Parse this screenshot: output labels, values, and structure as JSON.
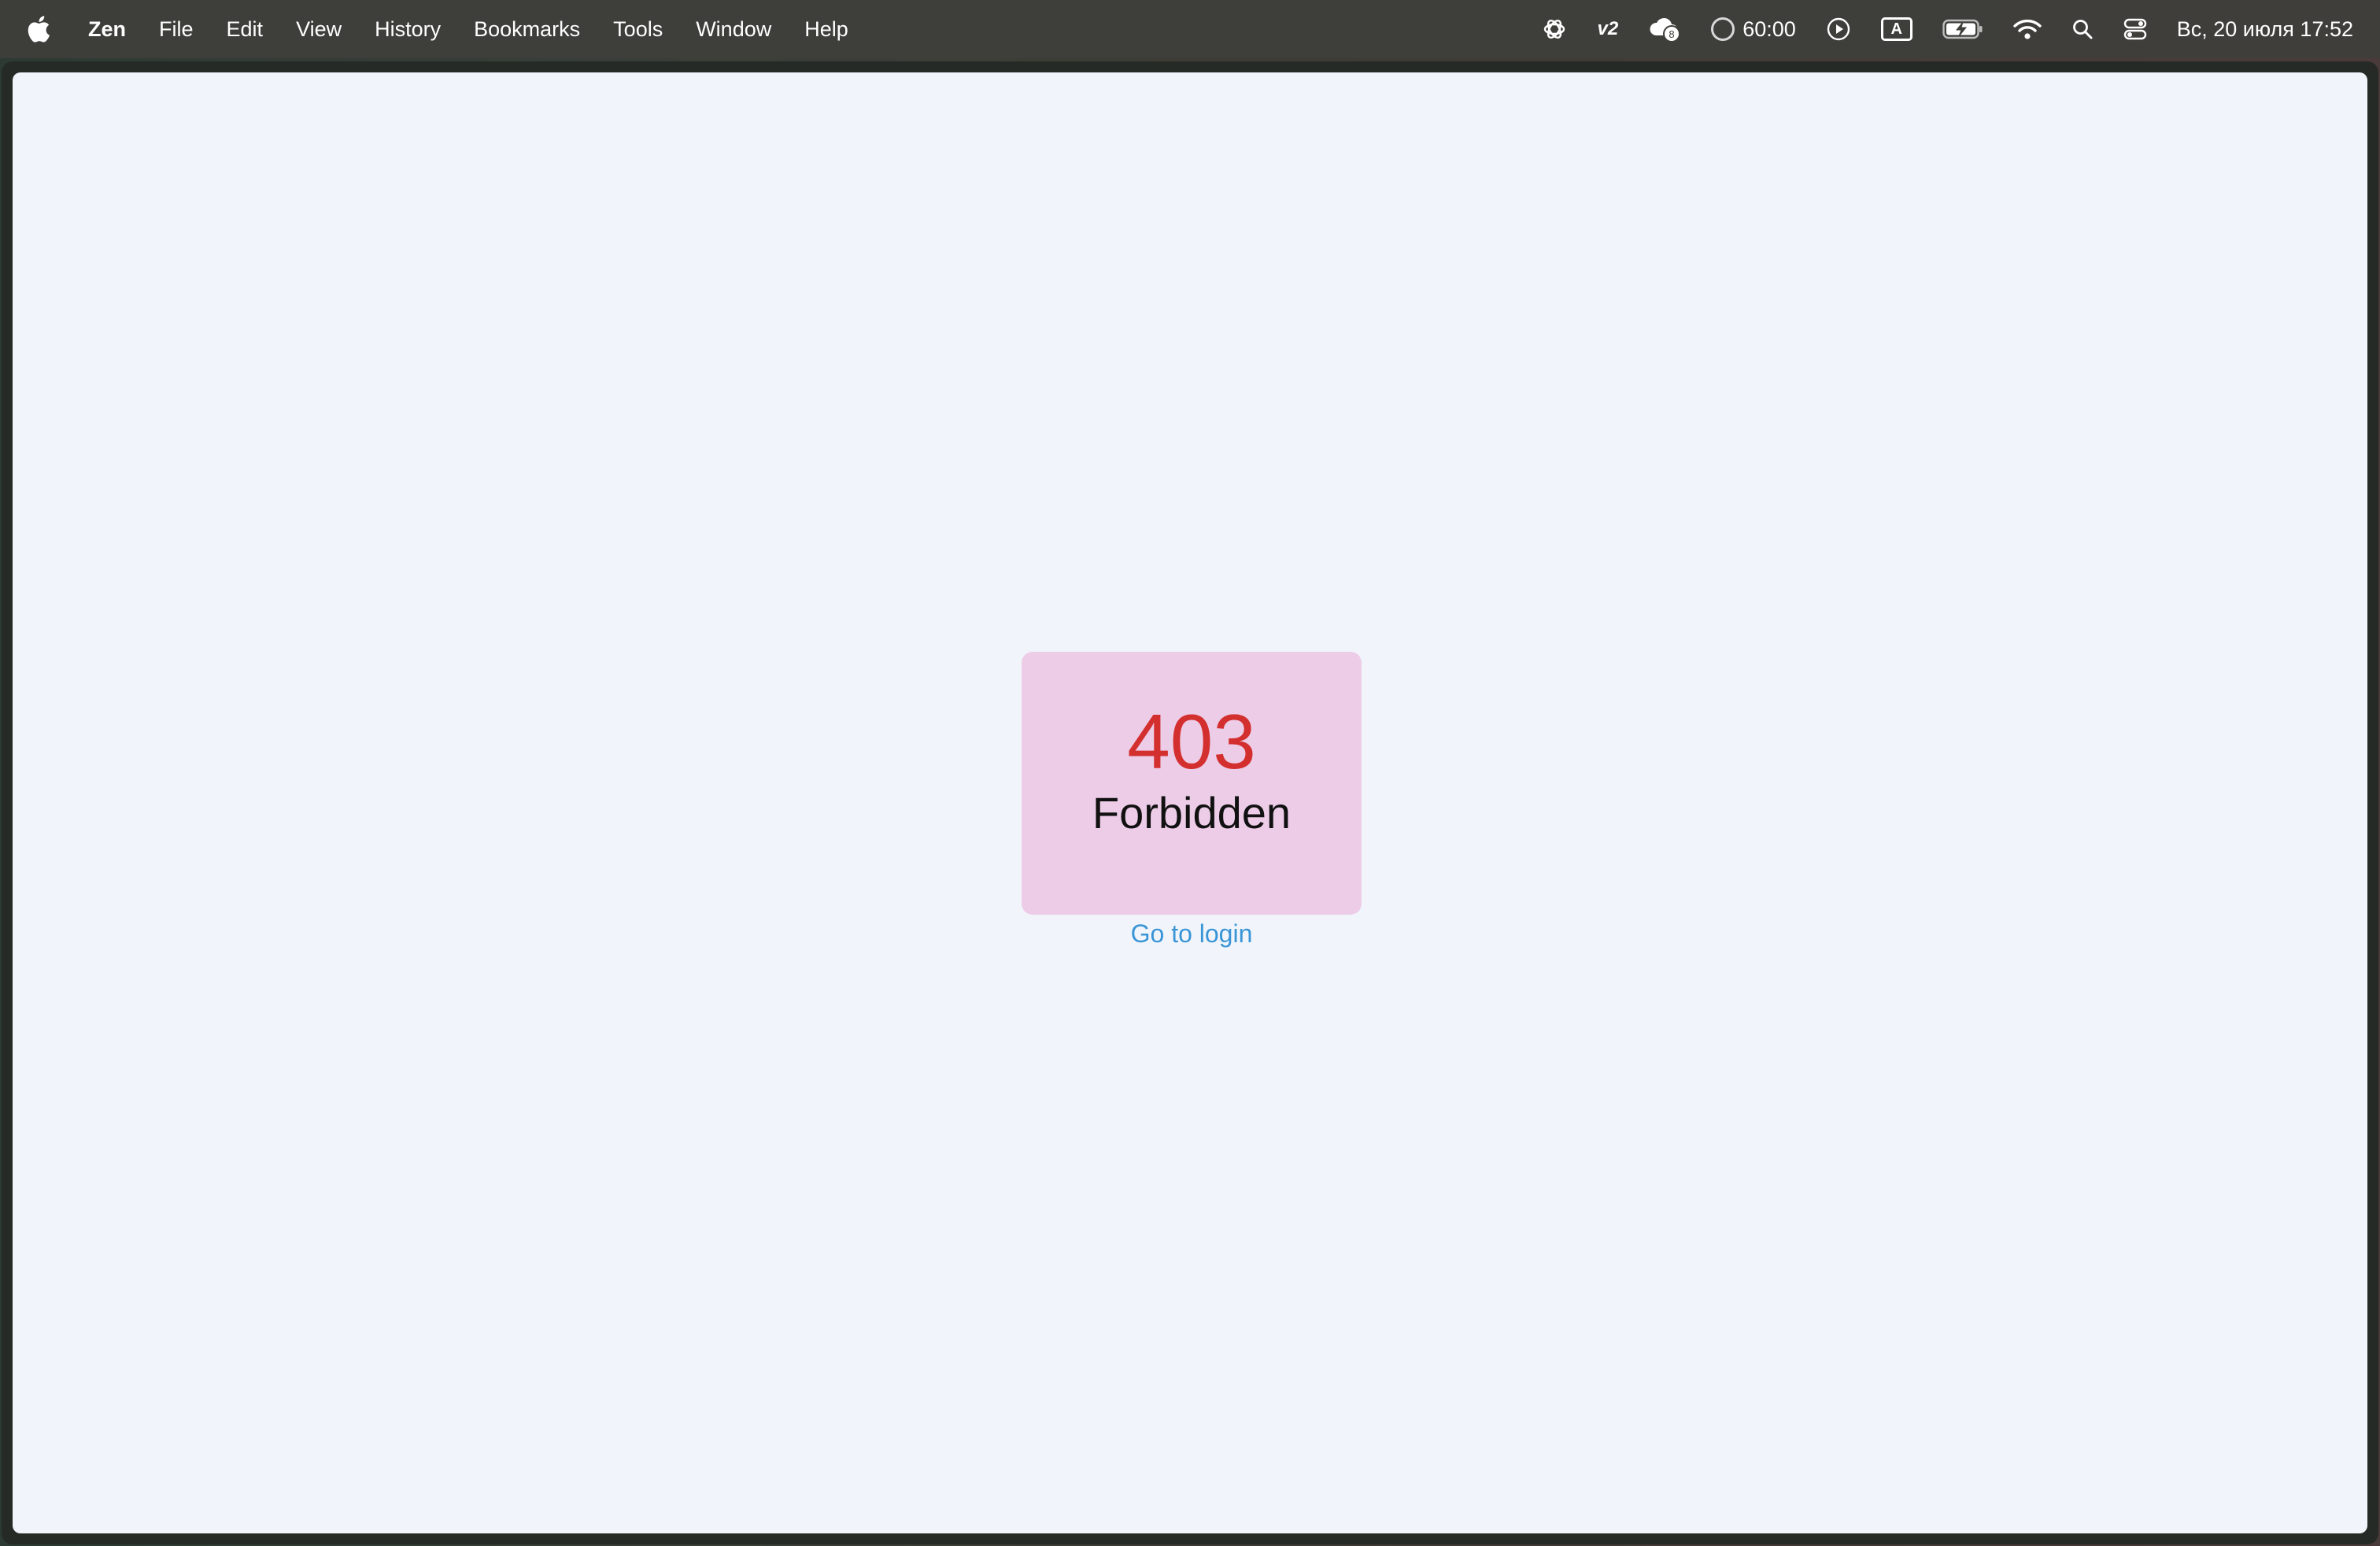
{
  "menubar": {
    "app_name": "Zen",
    "items": [
      "File",
      "Edit",
      "View",
      "History",
      "Bookmarks",
      "Tools",
      "Window",
      "Help"
    ],
    "tray": {
      "openai_icon": "openai-icon",
      "v2_label": "v2",
      "cloud_badge": "8",
      "timer": "60:00",
      "keyboard_layout": "A",
      "clock": "Вс, 20 июля  17:52"
    }
  },
  "page": {
    "error_code": "403",
    "error_text": "Forbidden",
    "link_label": "Go to login"
  },
  "colors": {
    "page_bg": "#f1f5fb",
    "card_bg": "#ecccE6",
    "code": "#d42f2f",
    "link": "#3a95d6"
  }
}
